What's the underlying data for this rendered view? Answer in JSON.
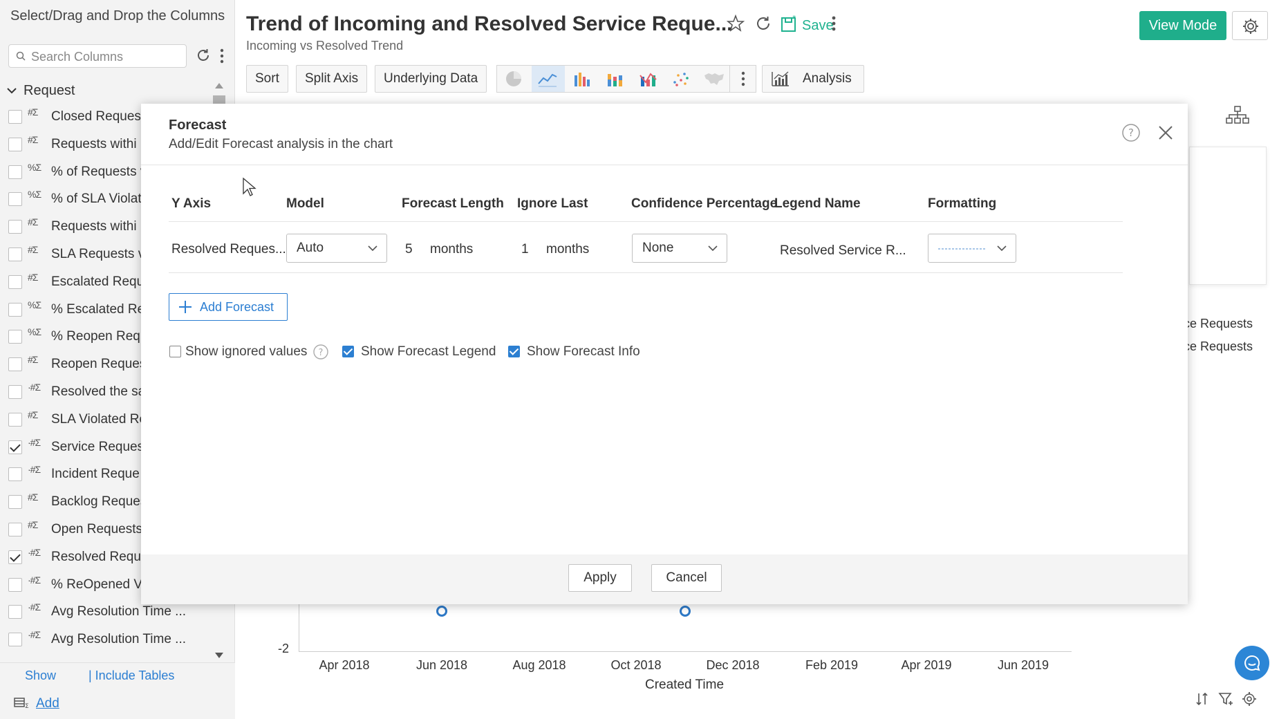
{
  "sidebar": {
    "title": "Select/Drag and Drop the Columns",
    "search_placeholder": "Search Columns",
    "group": "Request",
    "columns": [
      {
        "type": "#Σ",
        "name": "Closed Request",
        "checked": false
      },
      {
        "type": "#Σ",
        "name": "Requests withi",
        "checked": false
      },
      {
        "type": "%Σ",
        "name": "% of Requests v",
        "checked": false
      },
      {
        "type": "%Σ",
        "name": "% of SLA Violat",
        "checked": false
      },
      {
        "type": "#Σ",
        "name": "Requests withi",
        "checked": false
      },
      {
        "type": "#Σ",
        "name": "SLA Requests v",
        "checked": false
      },
      {
        "type": "#Σ",
        "name": "Escalated Requ",
        "checked": false
      },
      {
        "type": "%Σ",
        "name": "% Escalated Re",
        "checked": false
      },
      {
        "type": "%Σ",
        "name": "% Reopen Requ",
        "checked": false
      },
      {
        "type": "#Σ",
        "name": "Reopen Reques",
        "checked": false
      },
      {
        "type": "·#Σ",
        "name": "Resolved the sa",
        "checked": false
      },
      {
        "type": "#Σ",
        "name": "SLA Violated Re",
        "checked": false
      },
      {
        "type": "·#Σ",
        "name": "Service Reques",
        "checked": true
      },
      {
        "type": "·#Σ",
        "name": "Incident Reque",
        "checked": false
      },
      {
        "type": "#Σ",
        "name": "Backlog Reques",
        "checked": false
      },
      {
        "type": "#Σ",
        "name": "Open Requests",
        "checked": false
      },
      {
        "type": "·#Σ",
        "name": "Resolved Reque",
        "checked": true
      },
      {
        "type": "·#Σ",
        "name": "% ReOpened Vs",
        "checked": false
      },
      {
        "type": "·#Σ",
        "name": "Avg Resolution Time ...",
        "checked": false
      },
      {
        "type": "·#Σ",
        "name": "Avg Resolution Time ...",
        "checked": false
      }
    ],
    "footer_show": "Show",
    "footer_include": "| Include Tables",
    "footer_add": "Add"
  },
  "header": {
    "title": "Trend of Incoming and Resolved Service Reque...",
    "subtitle": "Incoming vs Resolved Trend",
    "save_label": "Save",
    "view_mode_label": "View Mode"
  },
  "toolbar": {
    "sort": "Sort",
    "split_axis": "Split Axis",
    "underlying_data": "Underlying Data",
    "analysis": "Analysis",
    "chart_types": [
      "pie-chart-icon",
      "line-chart-icon",
      "bar-chart-icon",
      "stacked-bar-icon",
      "combo-chart-icon",
      "scatter-chart-icon",
      "map-chart-icon"
    ],
    "active_chart": "line-chart-icon"
  },
  "background_chart": {
    "legend_1": "ce Requests",
    "legend_2": "ce Requests",
    "y_tick": "-2",
    "x_ticks": [
      "Apr 2018",
      "Jun 2018",
      "Aug 2018",
      "Oct 2018",
      "Dec 2018",
      "Feb 2019",
      "Apr 2019",
      "Jun 2019"
    ],
    "x_label": "Created Time",
    "series_color": "#2e79c7"
  },
  "dialog": {
    "title": "Forecast",
    "subtitle": "Add/Edit Forecast analysis in the chart",
    "columns": {
      "y_axis": "Y Axis",
      "model": "Model",
      "forecast_length": "Forecast Length",
      "ignore_last": "Ignore Last",
      "confidence": "Confidence Percentage",
      "legend_name": "Legend Name",
      "formatting": "Formatting"
    },
    "row": {
      "y_axis": "Resolved Reques...",
      "model": "Auto",
      "forecast_length": "5",
      "forecast_unit": "months",
      "ignore_last": "1",
      "ignore_unit": "months",
      "confidence": "None",
      "legend_name": "Resolved Service R..."
    },
    "add_forecast": "Add Forecast",
    "show_ignored": {
      "label": "Show ignored values",
      "checked": false
    },
    "show_legend": {
      "label": "Show Forecast Legend",
      "checked": true
    },
    "show_info": {
      "label": "Show Forecast Info",
      "checked": true
    },
    "apply": "Apply",
    "cancel": "Cancel"
  },
  "colors": {
    "accent": "#1fae8b",
    "link": "#2b7ed2"
  }
}
